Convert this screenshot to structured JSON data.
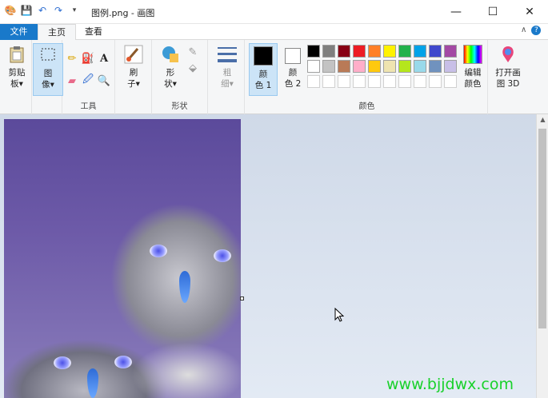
{
  "window": {
    "title": "图例.png - 画图",
    "controls": {
      "minimize": "—",
      "maximize": "☐",
      "close": "✕"
    }
  },
  "quick_access": {
    "icons": [
      "paint-app-icon",
      "save-icon",
      "undo-icon",
      "redo-icon",
      "customize-dropdown-icon"
    ]
  },
  "tabs": {
    "file": "文件",
    "home": "主页",
    "view": "查看"
  },
  "ribbon": {
    "clipboard": {
      "label": "剪贴\n板▾",
      "group": ""
    },
    "image": {
      "label": "图\n像▾"
    },
    "tools": {
      "group": "工具"
    },
    "brushes": {
      "label": "刷\n子▾"
    },
    "shapes": {
      "label": "形\n状▾",
      "group": "形状"
    },
    "size": {
      "label": "粗\n细▾"
    },
    "color1": {
      "label": "颜\n色 1",
      "value": "#000000"
    },
    "color2": {
      "label": "颜\n色 2",
      "value": "#ffffff"
    },
    "colors": {
      "group": "颜色"
    },
    "edit_colors": {
      "label": "编辑\n颜色"
    },
    "paint3d": {
      "label": "打开画\n图 3D"
    },
    "palette_row1": [
      "#000000",
      "#7f7f7f",
      "#880015",
      "#ed1c24",
      "#ff7f27",
      "#fff200",
      "#22b14c",
      "#00a2e8",
      "#3f48cc",
      "#a349a4"
    ],
    "palette_row2": [
      "#ffffff",
      "#c3c3c3",
      "#b97a57",
      "#ffaec9",
      "#ffc90e",
      "#efe4b0",
      "#b5e61d",
      "#99d9ea",
      "#7092be",
      "#c8bfe7"
    ],
    "palette_row3": [
      "#ffffff",
      "#ffffff",
      "#ffffff",
      "#ffffff",
      "#ffffff",
      "#ffffff",
      "#ffffff",
      "#ffffff",
      "#ffffff",
      "#ffffff"
    ]
  },
  "watermark": "www.bjjdwx.com"
}
